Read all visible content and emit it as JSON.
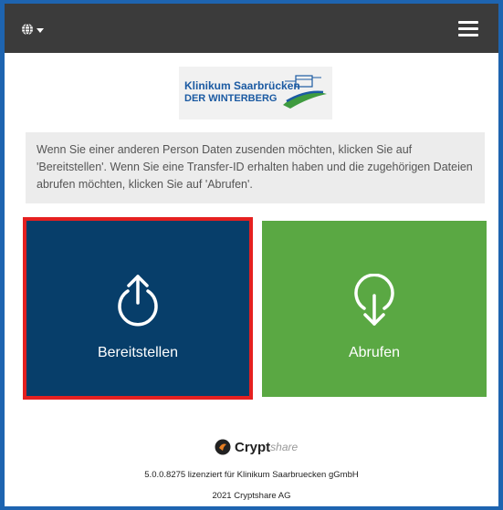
{
  "header": {
    "language_icon": "globe-icon",
    "menu_icon": "hamburger-menu-icon"
  },
  "logo": {
    "line1": "Klinikum Saarbrücken",
    "line2": "DER WINTERBERG"
  },
  "intro_text": "Wenn Sie einer anderen Person Daten zusenden möchten, klicken Sie auf 'Bereitstellen'. Wenn Sie eine Transfer-ID erhalten haben und die zugehörigen Dateien abrufen möchten, klicken Sie auf 'Abrufen'.",
  "actions": {
    "provide": {
      "label": "Bereitstellen",
      "icon": "upload-arrow-icon",
      "color": "#073e6a",
      "highlight": "#e52020"
    },
    "retrieve": {
      "label": "Abrufen",
      "icon": "download-arrow-icon",
      "color": "#5aa843"
    }
  },
  "footer": {
    "brand_name": "Crypt",
    "brand_suffix": "share",
    "license": "5.0.0.8275 lizenziert für Klinikum Saarbruecken gGmbH",
    "copyright": "2021 Cryptshare AG"
  }
}
